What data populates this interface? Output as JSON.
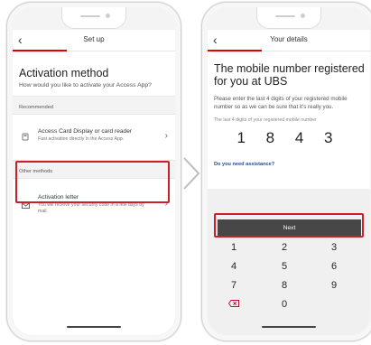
{
  "left_screen": {
    "nav_title": "Set up",
    "heading": "Activation method",
    "subheading": "How would you like to activate your Access App?",
    "section_recommended": "Recommended",
    "option_card": {
      "title": "Access Card Display or card reader",
      "desc": "Fast activation directly in the Access App.",
      "icon": "card-reader-icon"
    },
    "section_other": "Other methods",
    "option_letter": {
      "title": "Activation letter",
      "desc": "You will receive your security code in a few days by mail.",
      "icon": "envelope-icon"
    }
  },
  "right_screen": {
    "nav_title": "Your details",
    "heading": "The mobile number registered for you at UBS",
    "paragraph": "Please enter the last 4 digits of your registered mobile number so as we can be sure that it's really you.",
    "input_label": "The last 4 digits of your registered mobile number",
    "digits": "1 8 4 3",
    "assist_link": "Do you need assistance?",
    "next_label": "Next",
    "keys": [
      "1",
      "2",
      "3",
      "4",
      "5",
      "6",
      "7",
      "8",
      "9",
      "0"
    ],
    "delete_icon": "backspace-icon"
  },
  "colors": {
    "accent_red": "#e60000",
    "highlight_red": "#cc1f2b",
    "button_dark": "#474747",
    "link_blue": "#1f4d8f"
  }
}
